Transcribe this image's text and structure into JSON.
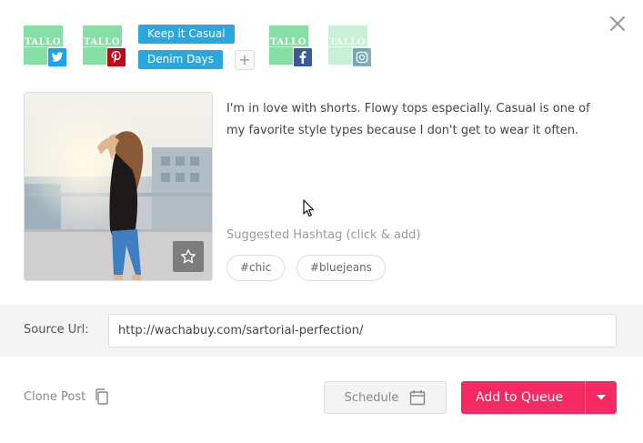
{
  "accounts": [
    {
      "logo_text": "TALLO",
      "network": "twitter",
      "network_icon": "twitter-icon",
      "color": "#1da1f2",
      "enabled": true
    },
    {
      "logo_text": "TALLO",
      "network": "pinterest",
      "network_icon": "pinterest-icon",
      "color": "#bd081c",
      "enabled": true
    },
    {
      "logo_text": "TALLO",
      "network": "facebook",
      "network_icon": "facebook-icon",
      "color": "#3b5998",
      "enabled": true
    },
    {
      "logo_text": "TALLO",
      "network": "instagram",
      "network_icon": "instagram-icon",
      "color": "#3f729b",
      "enabled": false
    }
  ],
  "boards": [
    "Keep it Casual",
    "Denim Days"
  ],
  "add_board_label": "+",
  "caption": "I'm in love with shorts. Flowy tops especially. Casual is one of\nmy favorite style types because I don't get to wear it often.",
  "suggested": {
    "label": "Suggested Hashtag (click & add)",
    "hashtags": [
      "#chic",
      "#bluejeans"
    ]
  },
  "source": {
    "label": "Source Url:",
    "value": "http://wachabuy.com/sartorial-perfection/"
  },
  "footer": {
    "clone_label": "Clone Post",
    "schedule_label": "Schedule",
    "add_to_queue_label": "Add to Queue"
  },
  "colors": {
    "accent": "#f52a62",
    "board_chip": "#29a8e0",
    "account_logo": "#86e0a6"
  }
}
